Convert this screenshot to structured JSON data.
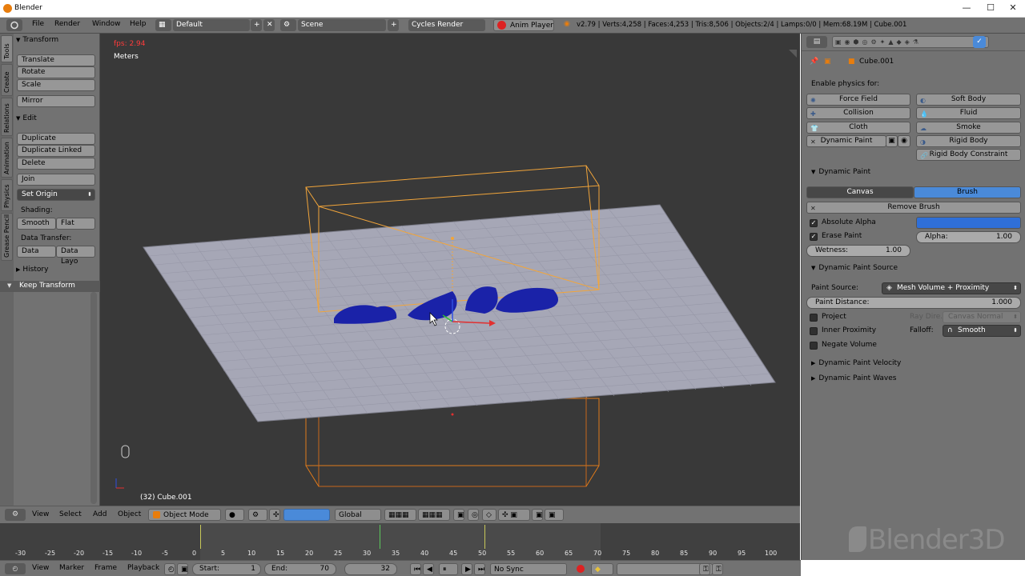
{
  "os": {
    "title": "Blender",
    "minimize": "—",
    "maximize": "☐",
    "close": "✕"
  },
  "info_header": {
    "menus": [
      "File",
      "Render",
      "Window",
      "Help"
    ],
    "layout": "Default",
    "scene": "Scene",
    "engine": "Cycles Render",
    "anim_player": "Anim Player",
    "stats": "v2.79 | Verts:4,258 | Faces:4,253 | Tris:8,506 | Objects:2/4 | Lamps:0/0 | Mem:68.19M | Cube.001"
  },
  "tool_tabs": [
    "Tools",
    "Create",
    "Relations",
    "Animation",
    "Physics",
    "Grease Pencil"
  ],
  "toolshelf": {
    "transform_header": "Transform",
    "translate": "Translate",
    "rotate": "Rotate",
    "scale": "Scale",
    "mirror": "Mirror",
    "edit_header": "Edit",
    "duplicate": "Duplicate",
    "duplicate_linked": "Duplicate Linked",
    "delete": "Delete",
    "join": "Join",
    "set_origin": "Set Origin",
    "shading_label": "Shading:",
    "smooth": "Smooth",
    "flat": "Flat",
    "data_transfer_label": "Data Transfer:",
    "data": "Data",
    "data_layout": "Data Layo",
    "history_header": "History",
    "keep_transform": "Keep Transform"
  },
  "viewport": {
    "fps": "fps: 2.94",
    "units": "Meters",
    "object_label": "(32) Cube.001"
  },
  "viewport_header": {
    "menus": [
      "View",
      "Select",
      "Add",
      "Object"
    ],
    "mode": "Object Mode",
    "orientation": "Global"
  },
  "timeline": {
    "ticks": [
      "-30",
      "-25",
      "-20",
      "-15",
      "-10",
      "-5",
      "0",
      "5",
      "10",
      "15",
      "20",
      "25",
      "30",
      "35",
      "40",
      "45",
      "50",
      "55",
      "60",
      "65",
      "70",
      "75",
      "80",
      "85",
      "90",
      "95",
      "100"
    ],
    "menus": [
      "View",
      "Marker",
      "Frame",
      "Playback"
    ],
    "start_label": "Start:",
    "start_value": "1",
    "end_label": "End:",
    "end_value": "70",
    "current_frame": "32",
    "sync": "No Sync"
  },
  "properties": {
    "object_name": "Cube.001",
    "enable_physics_label": "Enable physics for:",
    "physics_buttons": {
      "force_field": "Force Field",
      "soft_body": "Soft Body",
      "collision": "Collision",
      "fluid": "Fluid",
      "cloth": "Cloth",
      "smoke": "Smoke",
      "dynamic_paint": "Dynamic Paint",
      "rigid_body": "Rigid Body",
      "rigid_body_constraint": "Rigid Body Constraint"
    },
    "dynamic_paint_header": "Dynamic Paint",
    "canvas_tab": "Canvas",
    "brush_tab": "Brush",
    "remove_brush": "Remove Brush",
    "absolute_alpha": "Absolute Alpha",
    "erase_paint": "Erase Paint",
    "alpha_label": "Alpha:",
    "alpha_value": "1.00",
    "wetness_label": "Wetness:",
    "wetness_value": "1.00",
    "brush_color": "#2f6fd8",
    "source_header": "Dynamic Paint Source",
    "paint_source_label": "Paint Source:",
    "paint_source_value": "Mesh Volume + Proximity",
    "paint_distance_label": "Paint Distance:",
    "paint_distance_value": "1.000",
    "project": "Project",
    "ray_dir_label": "Ray Dire...",
    "ray_dir_value": "Canvas Normal",
    "inner_proximity": "Inner Proximity",
    "falloff_label": "Falloff:",
    "falloff_value": "Smooth",
    "negate_volume": "Negate Volume",
    "velocity_header": "Dynamic Paint Velocity",
    "waves_header": "Dynamic Paint Waves"
  },
  "watermark": "Blender3D",
  "colors": {
    "active_tab": "#4a8ad9",
    "selection_orange": "#f2a53a",
    "mesh_blue": "#1a22a8"
  }
}
